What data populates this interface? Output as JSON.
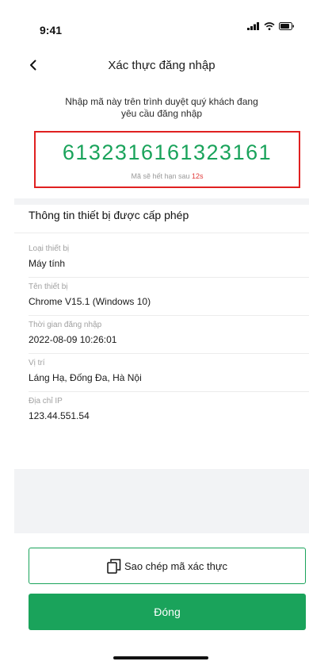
{
  "status_bar": {
    "time": "9:41"
  },
  "icons": {
    "back": "chevron-left-icon",
    "signal": "cellular-signal-icon",
    "wifi": "wifi-icon",
    "battery": "battery-icon",
    "copy": "copy-icon"
  },
  "colors": {
    "accent": "#1aa35b",
    "highlight_border": "#e02020",
    "countdown": "#e03a3a"
  },
  "header": {
    "title": "Xác thực đăng nhập"
  },
  "code_section": {
    "instruction": "Nhập mã này trên trình duyệt quý khách đang yêu cầu đăng nhập",
    "code": "6132316161323161",
    "expiry_prefix": "Mã sẽ hết hạn sau",
    "expiry_seconds": "12s"
  },
  "device_info": {
    "title": "Thông tin thiết bị được cấp phép",
    "fields": [
      {
        "label": "Loại thiết bị",
        "value": "Máy tính"
      },
      {
        "label": "Tên thiết bị",
        "value": "Chrome V15.1 (Windows 10)"
      },
      {
        "label": "Thời gian đăng nhập",
        "value": "2022-08-09 10:26:01"
      },
      {
        "label": "Vị trí",
        "value": "Láng Hạ, Đống Đa, Hà Nội"
      },
      {
        "label": "Địa chỉ IP",
        "value": "123.44.551.54"
      }
    ]
  },
  "actions": {
    "copy_label": "Sao chép mã xác thực",
    "close_label": "Đóng"
  }
}
